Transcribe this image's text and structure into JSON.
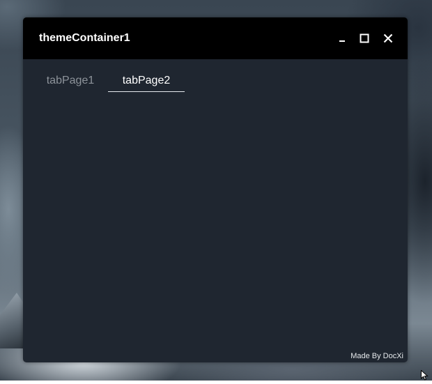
{
  "window": {
    "title": "themeContainer1",
    "controls": {
      "minimize_icon": "minimize-icon",
      "maximize_icon": "maximize-icon",
      "close_icon": "close-icon"
    }
  },
  "tabs": [
    {
      "label": "tabPage1",
      "selected": false
    },
    {
      "label": "tabPage2",
      "selected": true
    }
  ],
  "footer": {
    "credit": "Made By DocXi"
  },
  "colors": {
    "titlebar": "#000000",
    "body": "#1f2630",
    "tab_active": "#ffffff",
    "tab_inactive": "#8d939a"
  }
}
